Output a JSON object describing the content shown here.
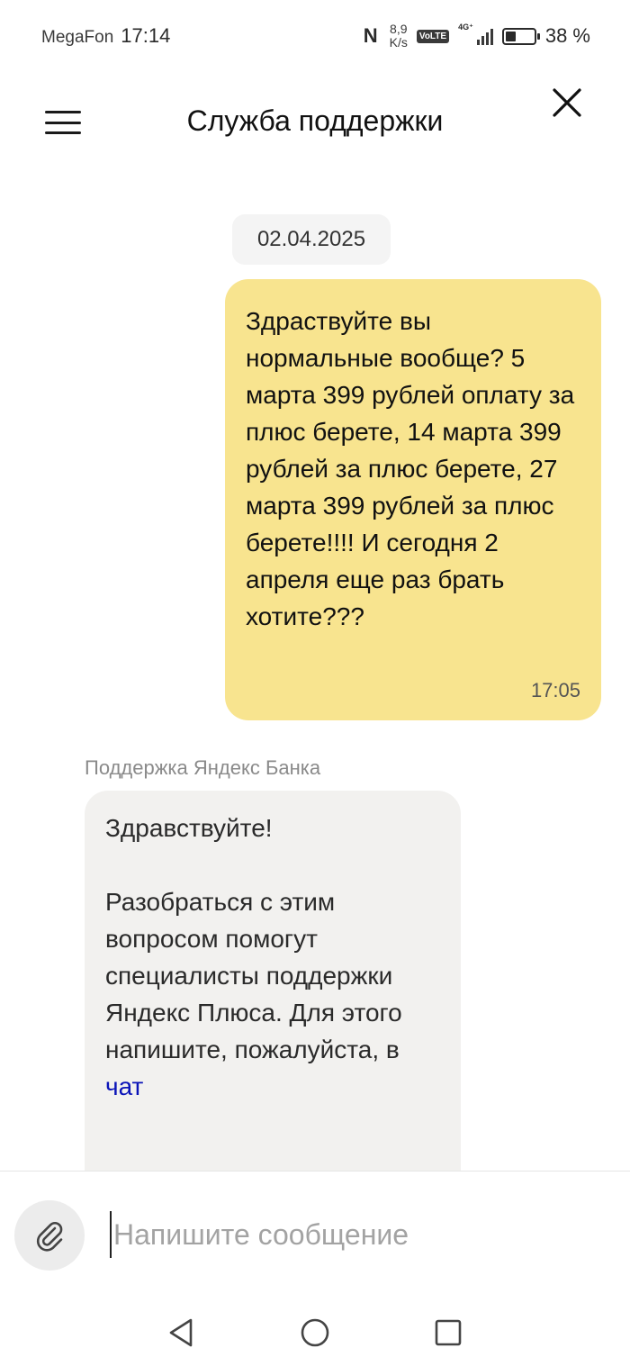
{
  "status_bar": {
    "carrier": "MegaFon",
    "time": "17:14",
    "speed_value": "8,9",
    "speed_unit": "K/s",
    "volte": "VoLTE",
    "network": "4G⁺",
    "battery_percent": "38 %",
    "battery_level": 0.38,
    "icons": [
      "nfc-icon",
      "volte-icon",
      "signal-icon",
      "battery-icon"
    ]
  },
  "header": {
    "title": "Служба поддержки",
    "menu_icon": "hamburger-menu-icon",
    "close_icon": "close-icon"
  },
  "chat": {
    "date": "02.04.2025",
    "messages": [
      {
        "direction": "outgoing",
        "text": "Здраствуйте вы нормальные вообще? 5 марта 399 рублей оплату за плюс берете, 14 марта 399 рублей за плюс берете, 27 марта 399 рублей за плюс берете!!!! И сегодня 2 апреля еще раз брать хотите???",
        "time": "17:05"
      },
      {
        "direction": "incoming",
        "sender": "Поддержка Яндекс Банка",
        "greeting": "Здравствуйте!",
        "body": "Разобраться с этим вопросом помогут специалисты поддержки Яндекс Плюса. Для этого напишите, пожалуйста, в",
        "link_text": "чат"
      }
    ]
  },
  "composer": {
    "placeholder": "Напишите сообщение",
    "attach_icon": "paperclip-icon"
  },
  "nav_bar": {
    "icons": [
      "back-icon",
      "home-icon",
      "recents-icon"
    ]
  },
  "colors": {
    "outgoing_bubble": "#f8e48f",
    "incoming_bubble": "#f2f1ef",
    "link": "#0b14b8",
    "date_chip": "#f4f4f4"
  }
}
